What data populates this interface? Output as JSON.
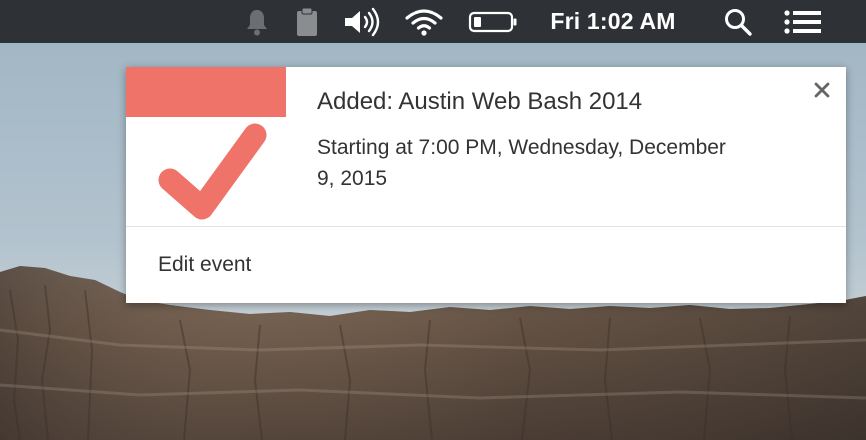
{
  "menubar": {
    "clock": "Fri 1:02 AM",
    "icons": [
      "notification-bell-icon",
      "clipboard-icon",
      "volume-icon",
      "wifi-icon",
      "battery-icon",
      "spotlight-search-icon",
      "notification-center-icon"
    ]
  },
  "notification": {
    "title": "Added: Austin Web Bash 2014",
    "body": "Starting at 7:00 PM, Wednesday, December 9, 2015",
    "action_label": "Edit event",
    "close_icon": "close-icon",
    "app_icon": "calendar-checkmark-icon",
    "accent_color": "#f0736a"
  }
}
